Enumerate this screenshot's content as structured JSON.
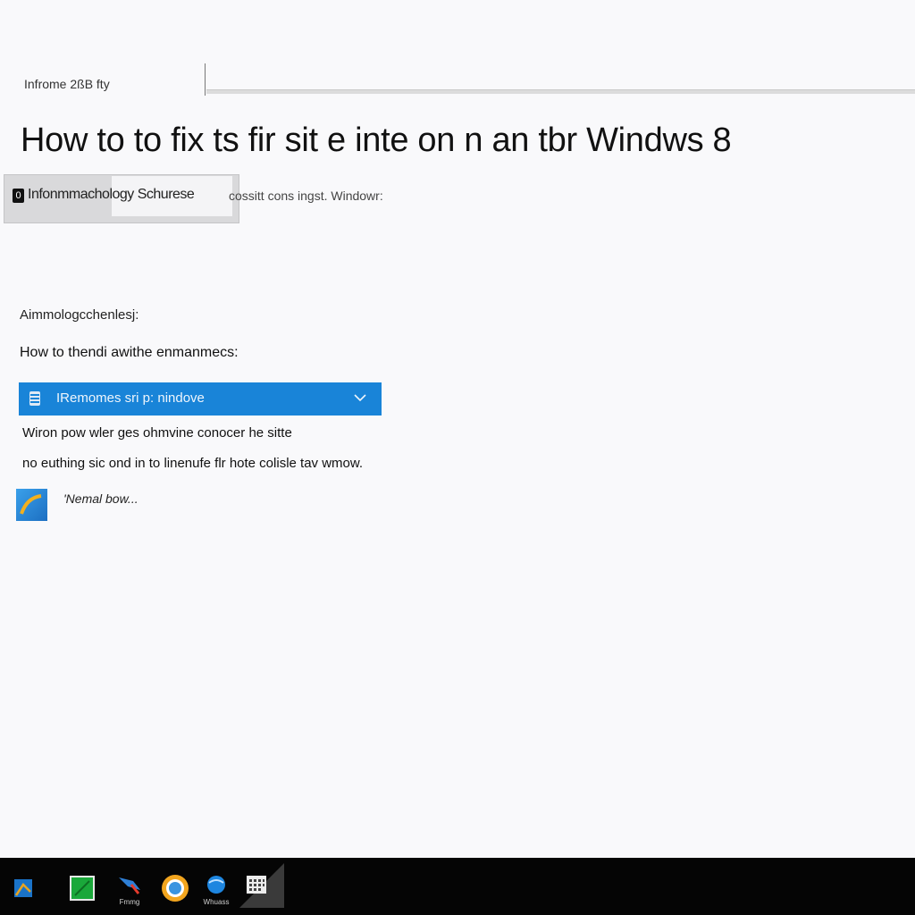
{
  "header": {
    "top_label": "Infrome 2ßB fty",
    "title": "How to to fix ts fir sit e inte on n an tbr Windws 8"
  },
  "tag": {
    "badge": "0",
    "text": "Infonmmachology Schurese",
    "subtext": "cossitt cons ingst. Windowr:"
  },
  "section": {
    "label": "Aimmologcсhenlesj:",
    "question": "How to thendi awithe enmanmecs:"
  },
  "dropdown": {
    "label": "IRemomes sri p: nindove",
    "icon": "document-icon",
    "chevron": "chevron-down-icon",
    "color": "#1984d8"
  },
  "body": {
    "line1": "Wiron pow wler geѕ ohmvine conocеr he sitte",
    "line2": "no euthing sic ond in to linenufe flr hote colisle tav wmow."
  },
  "app_link": {
    "label": "'Nemal bow...",
    "icon": "app-tile-icon"
  },
  "taskbar": {
    "items": [
      {
        "icon": "windows-start-icon",
        "caption": ""
      },
      {
        "icon": "green-app-icon",
        "caption": ""
      },
      {
        "icon": "flag-app-icon",
        "caption": "Fmmg"
      },
      {
        "icon": "browser-icon",
        "caption": ""
      },
      {
        "icon": "globe-icon",
        "caption": "Whuass"
      },
      {
        "icon": "calendar-icon",
        "caption": ""
      }
    ]
  }
}
